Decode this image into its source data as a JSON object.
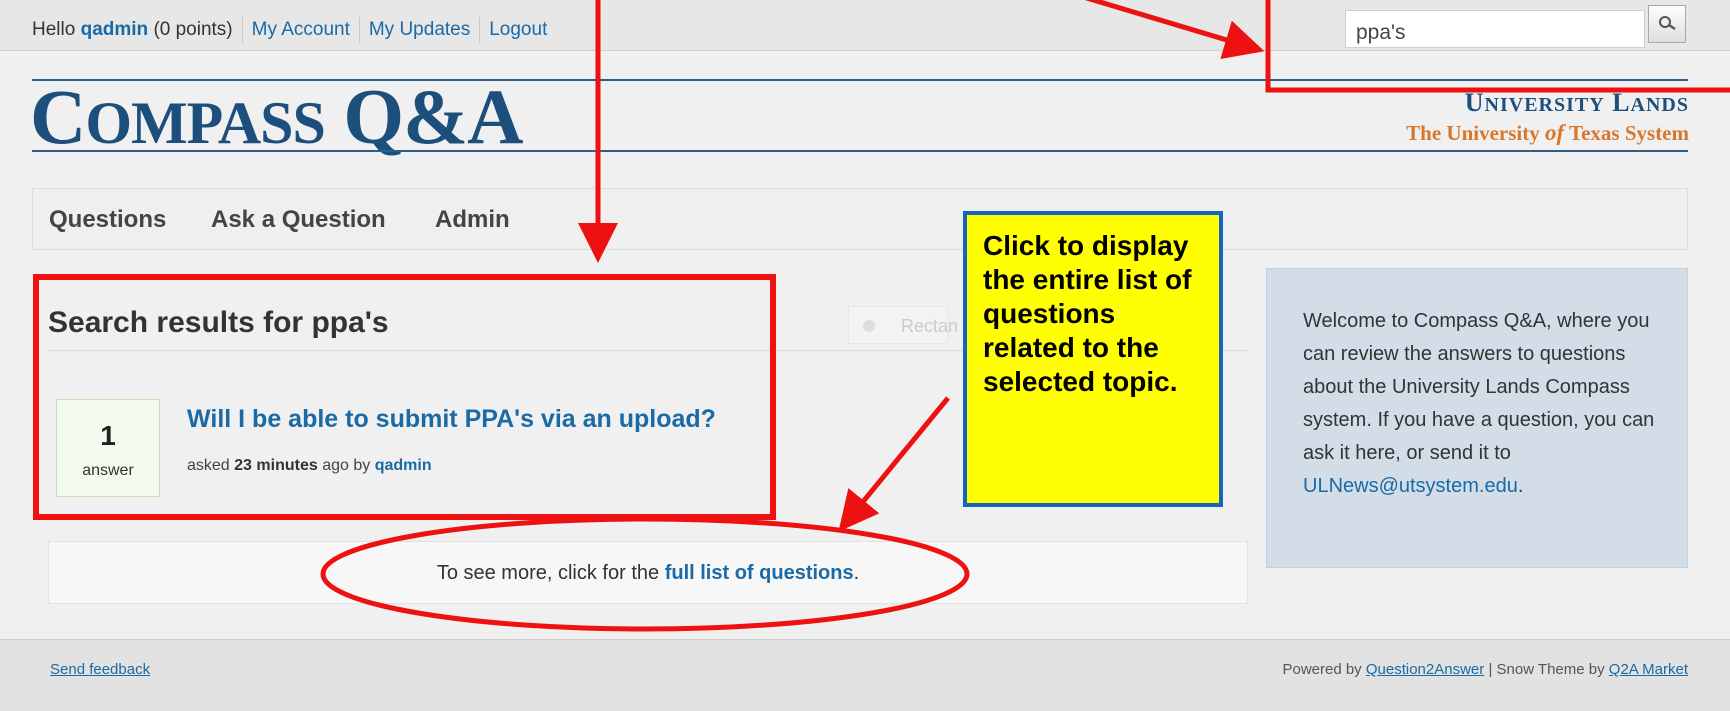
{
  "topbar": {
    "greeting_prefix": "Hello",
    "username": "qadmin",
    "points": "(0 points)",
    "links": [
      "My Account",
      "My Updates",
      "Logout"
    ]
  },
  "search": {
    "value": "ppa's"
  },
  "header": {
    "logo_first": "C",
    "logo_rest": "OMPASS",
    "logo_qa": "Q&A",
    "ul_line1_u": "U",
    "ul_line1_niversity": "NIVERSITY",
    "ul_line1_l": "L",
    "ul_line1_ands": "ANDS",
    "ul_line2_a": "The University",
    "ul_line2_of": "of",
    "ul_line2_b": "Texas System"
  },
  "nav": {
    "items": [
      "Questions",
      "Ask a Question",
      "Admin"
    ]
  },
  "main": {
    "results_title": "Search results for ppa's",
    "ghost_chip": "Rectan",
    "question": {
      "answer_count": "1",
      "answer_label": "answer",
      "title": "Will I be able to submit PPA's via an upload?",
      "meta_asked": "asked",
      "meta_when": "23 minutes",
      "meta_ago_by": "ago by",
      "meta_user": "qadmin"
    },
    "see_more_prefix": "To see more, click for the",
    "see_more_link": "full list of questions",
    "see_more_suffix": "."
  },
  "sidebar": {
    "text": "Welcome to Compass Q&A, where you can review the answers to questions about the University Lands Compass system. If you have a question, you can ask it here, or send it to",
    "email": "ULNews@utsystem.edu",
    "period": "."
  },
  "callout": {
    "text": "Click to display the entire list of questions related to the selected topic."
  },
  "footer": {
    "feedback": "Send feedback",
    "powered_prefix": "Powered by",
    "q2a": "Question2Answer",
    "theme_text": "| Snow Theme by",
    "market": "Q2A Market"
  },
  "colors": {
    "annotation_red": "#ee1111",
    "callout_yellow": "#fffe03",
    "callout_border": "#1565c0",
    "link_blue": "#1a6aa6"
  }
}
